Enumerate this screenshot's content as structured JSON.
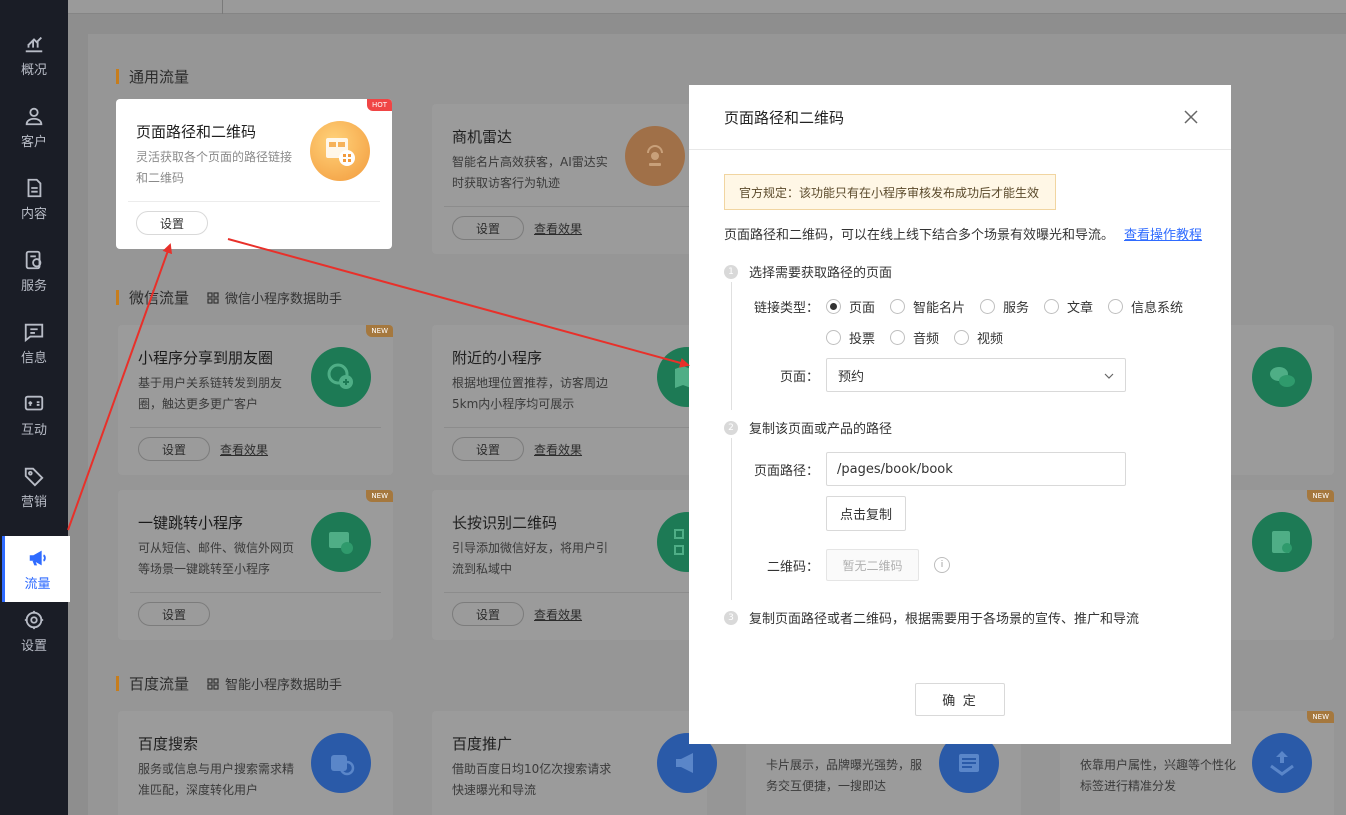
{
  "sidebar": {
    "items": [
      {
        "label": "概况",
        "icon": "chart-icon"
      },
      {
        "label": "客户",
        "icon": "user-icon"
      },
      {
        "label": "内容",
        "icon": "document-icon"
      },
      {
        "label": "服务",
        "icon": "service-icon"
      },
      {
        "label": "信息",
        "icon": "message-icon"
      },
      {
        "label": "互动",
        "icon": "interaction-icon"
      },
      {
        "label": "营销",
        "icon": "tag-icon"
      },
      {
        "label": "流量",
        "icon": "megaphone-icon",
        "active": true
      },
      {
        "label": "设置",
        "icon": "gear-icon"
      }
    ]
  },
  "sections": {
    "general": {
      "title": "通用流量"
    },
    "wechat": {
      "title": "微信流量",
      "sub": "微信小程序数据助手"
    },
    "baidu": {
      "title": "百度流量",
      "sub": "智能小程序数据助手"
    }
  },
  "cards": {
    "page_path": {
      "title": "页面路径和二维码",
      "desc": "灵活获取各个页面的路径链接和二维码",
      "badge": "HOT",
      "btn": "设置"
    },
    "radar": {
      "title": "商机雷达",
      "desc": "智能名片高效获客，AI雷达实时获取访客行为轨迹",
      "btn": "设置",
      "link": "查看效果"
    },
    "share": {
      "title": "小程序分享到朋友圈",
      "desc": "基于用户关系链转发到朋友圈，触达更多更广客户",
      "badge": "NEW",
      "btn": "设置",
      "link": "查看效果"
    },
    "nearby": {
      "title": "附近的小程序",
      "desc": "根据地理位置推荐，访客周边5km内小程序均可展示",
      "btn": "设置",
      "link": "查看效果"
    },
    "jump": {
      "title": "一键跳转小程序",
      "desc": "可从短信、邮件、微信外网页等场景一键跳转至小程序",
      "badge": "NEW",
      "btn": "设置"
    },
    "longpress": {
      "title": "长按识别二维码",
      "desc": "引导添加微信好友，将用户引流到私域中",
      "btn": "设置",
      "link": "查看效果"
    },
    "baidu_search": {
      "title": "百度搜索",
      "desc": "服务或信息与用户搜索需求精准匹配，深度转化用户"
    },
    "baidu_promo": {
      "title": "百度推广",
      "desc": "借助百度日均10亿次搜索请求快速曝光和导流"
    },
    "card_three": {
      "desc": "卡片展示，品牌曝光强势，服务交互便捷，一搜即达"
    },
    "card_four": {
      "desc": "依靠用户属性，兴趣等个性化标签进行精准分发",
      "badge": "NEW"
    },
    "right_new1": {
      "badge": "NEW"
    }
  },
  "modal": {
    "title": "页面路径和二维码",
    "notice": "官方规定：该功能只有在小程序审核发布成功后才能生效",
    "intro": "页面路径和二维码，可以在线上线下结合多个场景有效曝光和导流。",
    "tutorial_link": "查看操作教程",
    "step1": {
      "num": "1",
      "text": "选择需要获取路径的页面"
    },
    "step2": {
      "num": "2",
      "text": "复制该页面或产品的路径"
    },
    "step3": {
      "num": "3",
      "text": "复制页面路径或者二维码，根据需要用于各场景的宣传、推广和导流"
    },
    "link_type_label": "链接类型：",
    "link_types": [
      "页面",
      "智能名片",
      "服务",
      "文章",
      "信息系统",
      "投票",
      "音频",
      "视频"
    ],
    "selected_link_type": "页面",
    "page_label": "页面：",
    "page_value": "预约",
    "path_label": "页面路径：",
    "path_value": "/pages/book/book",
    "copy_btn": "点击复制",
    "qr_label": "二维码：",
    "qr_empty": "暂无二维码",
    "info_glyph": "i",
    "confirm": "确 定"
  }
}
